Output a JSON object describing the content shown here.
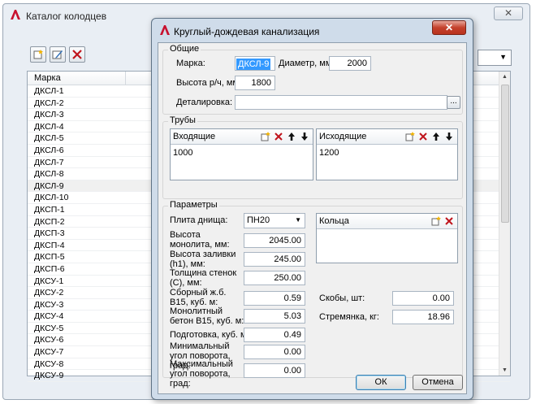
{
  "background_window": {
    "title": "Каталог колодцев",
    "close_label": "✕",
    "list_header": "Марка",
    "list_items": [
      "ДКСЛ-1",
      "ДКСЛ-2",
      "ДКСЛ-3",
      "ДКСЛ-4",
      "ДКСЛ-5",
      "ДКСЛ-6",
      "ДКСЛ-7",
      "ДКСЛ-8",
      "ДКСЛ-9",
      "ДКСЛ-10",
      "ДКСП-1",
      "ДКСП-2",
      "ДКСП-3",
      "ДКСП-4",
      "ДКСП-5",
      "ДКСП-6",
      "ДКСУ-1",
      "ДКСУ-2",
      "ДКСУ-3",
      "ДКСУ-4",
      "ДКСУ-5",
      "ДКСУ-6",
      "ДКСУ-7",
      "ДКСУ-8",
      "ДКСУ-9"
    ],
    "selected_index": 8,
    "combo_arrow": "▼"
  },
  "dialog": {
    "title": "Круглый-дождевая канализация",
    "close_label": "✕",
    "general": {
      "title": "Общие",
      "mark_label": "Марка:",
      "mark_value": "ДКСЛ-9",
      "diameter_label": "Диаметр, мм:",
      "diameter_value": "2000",
      "height_label": "Высота р/ч, мм:",
      "height_value": "1800",
      "detail_label": "Деталировка:",
      "detail_value": "",
      "browse_label": "..."
    },
    "pipes": {
      "title": "Трубы",
      "incoming_label": "Входящие",
      "incoming_value": "1000",
      "outgoing_label": "Исходящие",
      "outgoing_value": "1200"
    },
    "params": {
      "title": "Параметры",
      "slab_label": "Плита днища:",
      "slab_value": "ПН20",
      "monolith_height_label": "Высота монолита, мм:",
      "monolith_height_value": "2045.00",
      "fill_height_label": "Высота заливки (h1), мм:",
      "fill_height_value": "245.00",
      "wall_label": "Толщина стенок (С), мм:",
      "wall_value": "250.00",
      "precast_label": "Сборный ж.б. В15, куб. м:",
      "precast_value": "0.59",
      "monolithic_concrete_label": "Монолитный бетон В15, куб. м:",
      "monolithic_concrete_value": "5.03",
      "prep_label": "Подготовка, куб. м:",
      "prep_value": "0.49",
      "min_angle_label": "Минимальный угол поворота, град:",
      "min_angle_value": "0.00",
      "max_angle_label": "Максимальный угол поворота, град:",
      "max_angle_value": "0.00",
      "rings_label": "Кольца",
      "brackets_label": "Скобы, шт:",
      "brackets_value": "0.00",
      "ladder_label": "Стремянка, кг:",
      "ladder_value": "18.96"
    },
    "ok_label": "ОК",
    "cancel_label": "Отмена"
  }
}
